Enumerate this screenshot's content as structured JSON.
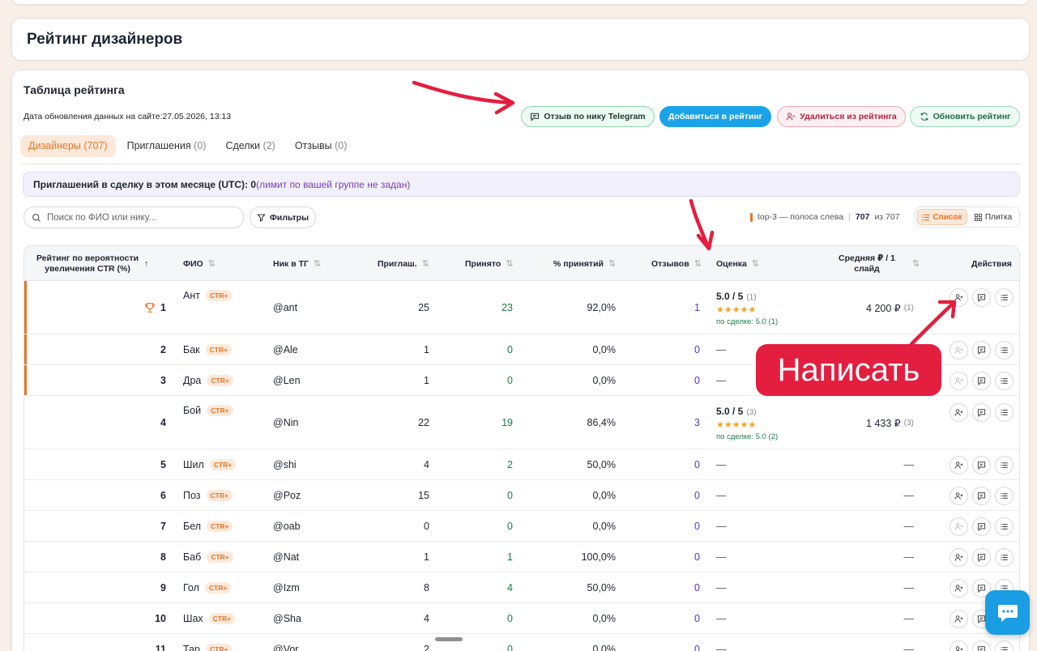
{
  "page": {
    "title": "Рейтинг дизайнеров"
  },
  "section": {
    "title": "Таблица рейтинга",
    "updated_label": "Дата обновления данных на сайте:",
    "updated_value": "27.05.2026, 13:13"
  },
  "actions": {
    "review_telegram": "Отзыв по нику Telegram",
    "add_rating": "Добавиться в рейтинг",
    "remove_rating": "Удалиться из рейтинга",
    "refresh_rating": "Обновить рейтинг"
  },
  "tabs": [
    {
      "label": "Дизайнеры",
      "count": "(707)"
    },
    {
      "label": "Приглашения",
      "count": "(0)"
    },
    {
      "label": "Сделки",
      "count": "(2)"
    },
    {
      "label": "Отзывы",
      "count": "(0)"
    }
  ],
  "notice": {
    "label": "Приглашений в сделку в этом месяце (UTC):",
    "value": "0",
    "limit": "(лимит по вашей группе не задан)"
  },
  "search": {
    "placeholder": "Поиск по ФИО или нику..."
  },
  "filters": {
    "label": "Фильтры"
  },
  "legend": {
    "top3": "top-3 — полоса слева",
    "shown": "707",
    "of": "из 707"
  },
  "view": {
    "list": "Список",
    "tiles": "Плитка"
  },
  "table": {
    "headers": {
      "rank": "Рейтинг по вероятности увеличения CTR (%)",
      "name": "ФИО",
      "nick": "Ник в ТГ",
      "invited": "Приглаш.",
      "accepted": "Принято",
      "pct": "% принятий",
      "reviews": "Отзывов",
      "rating": "Оценка",
      "price": "Средняя ₽ / 1 слайд",
      "actions": "Действия"
    },
    "badge": "CTR+",
    "rows": [
      {
        "rank": "1",
        "name": "Ант",
        "nick": "@ant",
        "invited": "25",
        "accepted": "23",
        "pct": "92,0%",
        "reviews": "1",
        "rating": "5.0 / 5",
        "rating_n": "(1)",
        "stars": "★★★★★",
        "deal": "по сделке: 5.0 (1)",
        "price": "4 200 ₽",
        "price_n": "(1)",
        "top3": true,
        "trophy": true
      },
      {
        "rank": "2",
        "name": "Бак",
        "nick": "@Ale",
        "invited": "1",
        "accepted": "0",
        "pct": "0,0%",
        "reviews": "0",
        "rating": "—",
        "price": "",
        "top3": true
      },
      {
        "rank": "3",
        "name": "Дра",
        "nick": "@Len",
        "invited": "1",
        "accepted": "0",
        "pct": "0,0%",
        "reviews": "0",
        "rating": "—",
        "price": "",
        "top3": true
      },
      {
        "rank": "4",
        "name": "Бой",
        "nick": "@Nin",
        "invited": "22",
        "accepted": "19",
        "pct": "86,4%",
        "reviews": "3",
        "rating": "5.0 / 5",
        "rating_n": "(3)",
        "stars": "★★★★★",
        "deal": "по сделке: 5.0 (2)",
        "price": "1 433 ₽",
        "price_n": "(3)"
      },
      {
        "rank": "5",
        "name": "Шил",
        "nick": "@shi",
        "invited": "4",
        "accepted": "2",
        "pct": "50,0%",
        "reviews": "0",
        "rating": "—",
        "price": "—"
      },
      {
        "rank": "6",
        "name": "Поз",
        "nick": "@Poz",
        "invited": "15",
        "accepted": "0",
        "pct": "0,0%",
        "reviews": "0",
        "rating": "—",
        "price": "—"
      },
      {
        "rank": "7",
        "name": "Бел",
        "nick": "@oab",
        "invited": "0",
        "accepted": "0",
        "pct": "0,0%",
        "reviews": "0",
        "rating": "—",
        "price": "—",
        "dim_invite": true
      },
      {
        "rank": "8",
        "name": "Баб",
        "nick": "@Nat",
        "invited": "1",
        "accepted": "1",
        "pct": "100,0%",
        "reviews": "0",
        "rating": "—",
        "price": "—"
      },
      {
        "rank": "9",
        "name": "Гол",
        "nick": "@Izm",
        "invited": "8",
        "accepted": "4",
        "pct": "50,0%",
        "reviews": "0",
        "rating": "—",
        "price": "—"
      },
      {
        "rank": "10",
        "name": "Шах",
        "nick": "@Sha",
        "invited": "4",
        "accepted": "0",
        "pct": "0,0%",
        "reviews": "0",
        "rating": "—",
        "price": "—"
      },
      {
        "rank": "11",
        "name": "Тар",
        "nick": "@Vor",
        "invited": "2",
        "accepted": "0",
        "pct": "0,0%",
        "reviews": "0",
        "rating": "—",
        "price": "—"
      }
    ]
  },
  "annotation": {
    "write": "Написать"
  },
  "colors": {
    "accent_orange": "#e8742a",
    "primary_blue": "#1aa3e8",
    "annotation_red": "#e41e3f",
    "accepted_green": "#1d7a4c",
    "reviews_purple": "#5b34b8"
  }
}
